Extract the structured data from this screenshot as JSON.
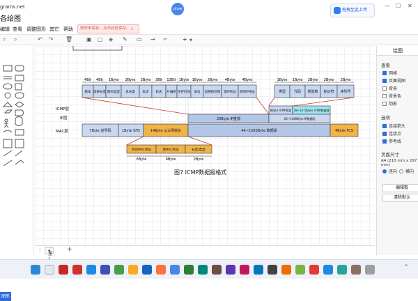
{
  "window": {
    "domain_text": "grams.net",
    "app_title": "各绘图",
    "upload_button": "拖拽至此上传",
    "minimize": "—",
    "maximize": "☐",
    "close": "✕"
  },
  "menu": [
    "编辑",
    "查看",
    "调整图形",
    "其它",
    "帮助"
  ],
  "unsaved_notice": "修改未保存，点击此处保存。",
  "toolbar": {
    "zoom_plus": "+"
  },
  "left_panel": {
    "more_shapes": "图形"
  },
  "diagram": {
    "caption": "图7 ICMP数据报格式",
    "row_labels": [
      "ICMP层",
      "IP层",
      "MAC层"
    ],
    "ip_header_widths": [
      "4Bit",
      "4Bit",
      "1Byte",
      "2Byte",
      "2Byte",
      "3Bit",
      "13Bit",
      "1Byte",
      "1Byte",
      "2Byte",
      "4Byte",
      "4Byte"
    ],
    "ip_header_fields": [
      "版本",
      "首部长度",
      "服务类型",
      "总长度",
      "标识",
      "标志",
      "片偏移",
      "生存时间",
      "协议",
      "首部校验和",
      "源IP地址",
      "目的IP地址"
    ],
    "icmp_widths": [
      "1Byte",
      "1Byte",
      "2Byte",
      "2Byte",
      "2Byte"
    ],
    "icmp_fields": [
      "类型",
      "代码",
      "校验和",
      "标识符",
      "序列号"
    ],
    "ip_header_box": "20Byte IP首部",
    "icmp_header_box": "8Byte ICMP首部",
    "icmp_data_box": "18~1472Byte ICMP数据域",
    "ip_data_box": "26~1480Byte IP数据段",
    "preamble": "7Byte 前导码",
    "sfd": "1Byte SFD",
    "eth_header": "14Byte 以太网帧头",
    "mac_data": "46~1500Byte 数据段",
    "fcs": "4Byte FCS",
    "eth_fields": [
      "目的MAC地址",
      "源MAC地址",
      "长度/类型"
    ],
    "eth_widths": [
      "6Byte",
      "6Byte",
      "2Byte"
    ]
  },
  "page_tab": "第 1 页",
  "right_panel": {
    "title": "绘图",
    "view_section": "查看",
    "view_options": [
      {
        "label": "网格",
        "checked": true
      },
      {
        "label": "页面视图",
        "checked": true
      },
      {
        "label": "背景",
        "checked": false
      },
      {
        "label": "背景色",
        "checked": false
      },
      {
        "label": "阴影",
        "checked": false
      }
    ],
    "options_section": "选项",
    "options": [
      {
        "label": "连接箭头",
        "checked": true
      },
      {
        "label": "连接点",
        "checked": true
      },
      {
        "label": "参考线",
        "checked": true
      }
    ],
    "page_size_section": "页面尺寸",
    "page_size_value": "A4 (210 mm x 297 mm)",
    "orientation": [
      "竖向",
      "横向"
    ],
    "edit_data_button": "编辑数",
    "clear_default_button": "清除默认"
  },
  "colors": {
    "field_blue": "#c9d7f0",
    "ip_blue": "#b3c6e7",
    "icmp_cyan": "#9fe6f3",
    "eth_orange": "#f2b24a",
    "accent": "#2d6cdf",
    "arrow_red": "#c0392b"
  }
}
